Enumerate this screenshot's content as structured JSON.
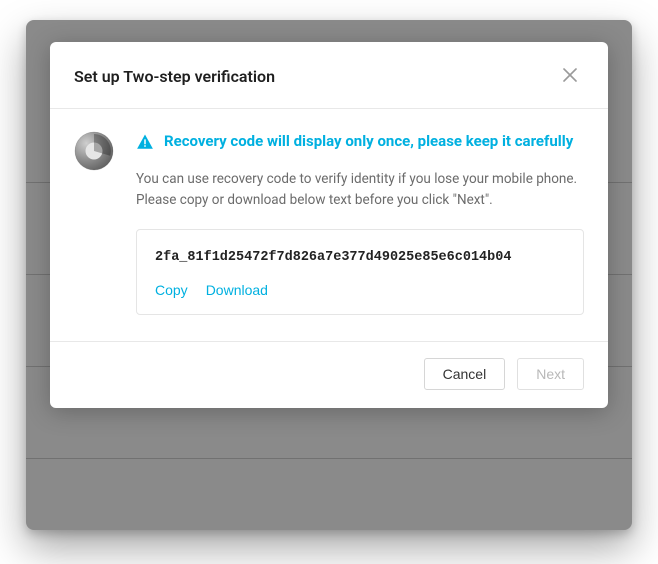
{
  "colors": {
    "accent": "#00b0e0"
  },
  "modal": {
    "title": "Set up Two-step verification",
    "headline": "Recovery code will display only once, please keep it carefully",
    "description_line1": "You can use recovery code to verify identity if you lose your mobile phone.",
    "description_line2": "Please copy or download below text before you click \"Next\".",
    "recovery_code": "2fa_81f1d25472f7d826a7e377d49025e85e6c014b04",
    "actions": {
      "copy": "Copy",
      "download": "Download"
    },
    "footer": {
      "cancel": "Cancel",
      "next": "Next"
    }
  },
  "icons": {
    "close": "close-icon",
    "warning": "warning-triangle-icon",
    "authenticator": "authenticator-app-icon"
  }
}
